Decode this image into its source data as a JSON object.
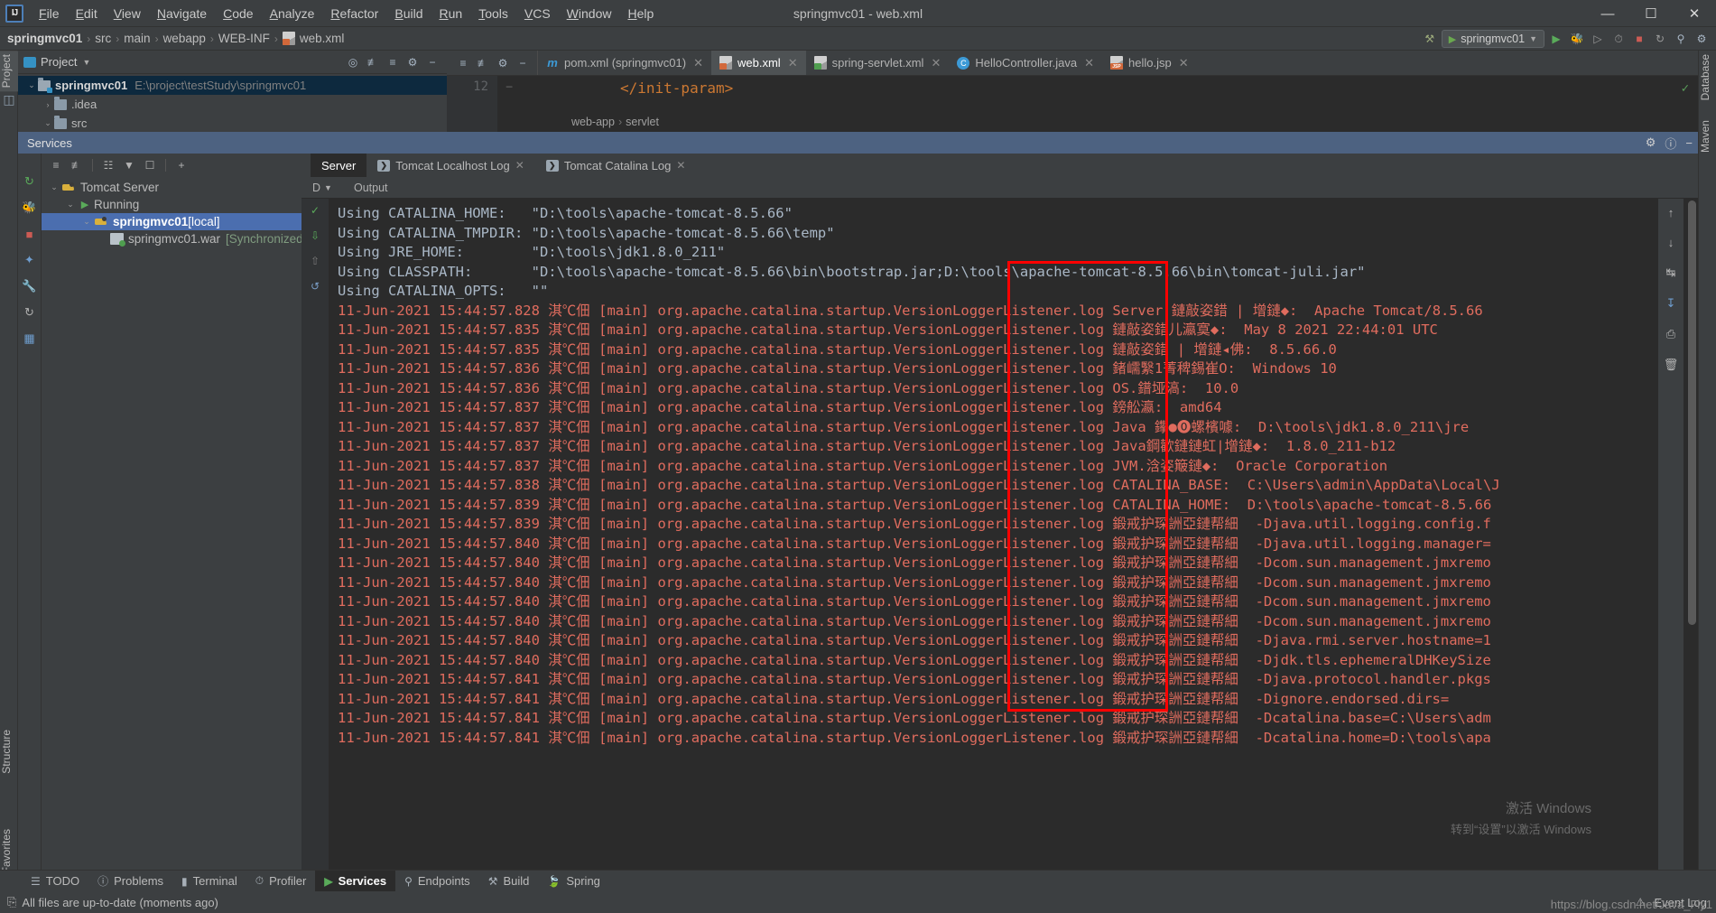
{
  "window": {
    "title": "springmvc01 - web.xml",
    "controls": {
      "minimize": "—",
      "maximize": "☐",
      "close": "✕"
    }
  },
  "menu": {
    "items": [
      "File",
      "Edit",
      "View",
      "Navigate",
      "Code",
      "Analyze",
      "Refactor",
      "Build",
      "Run",
      "Tools",
      "VCS",
      "Window",
      "Help"
    ]
  },
  "navbar": {
    "crumbs": [
      "springmvc01",
      "src",
      "main",
      "webapp",
      "WEB-INF",
      "web.xml"
    ],
    "run_config": "springmvc01",
    "sep": "›"
  },
  "left_strip": {
    "project_label": "Project",
    "structure_label": "Structure",
    "favorites_label": "Favorites"
  },
  "right_strip": {
    "database_label": "Database",
    "maven_label": "Maven"
  },
  "project_panel": {
    "title": "Project",
    "tree": [
      {
        "label": "springmvc01",
        "path": "E:\\project\\testStudy\\springmvc01",
        "bold": true,
        "selected": true,
        "arrow": "⌄",
        "indent": 0
      },
      {
        "label": ".idea",
        "path": "",
        "bold": false,
        "selected": false,
        "arrow": "›",
        "indent": 1
      },
      {
        "label": "src",
        "path": "",
        "bold": false,
        "selected": false,
        "arrow": "⌄",
        "indent": 1
      }
    ]
  },
  "editor": {
    "tabs": [
      {
        "label": "pom.xml (springmvc01)",
        "icon": "maven-icon",
        "active": false
      },
      {
        "label": "web.xml",
        "icon": "xml-file-icon",
        "active": true
      },
      {
        "label": "spring-servlet.xml",
        "icon": "xml-file-ok-icon",
        "active": false
      },
      {
        "label": "HelloController.java",
        "icon": "java-class-icon",
        "active": false
      },
      {
        "label": "hello.jsp",
        "icon": "jsp-file-icon",
        "active": false
      }
    ],
    "line_number": "12",
    "code_line": "</init-param>",
    "breadcrumbs": [
      "web-app",
      "servlet"
    ],
    "close_glyph": "✕"
  },
  "services": {
    "title": "Services",
    "toolbar_icons": [
      "expand-all-icon",
      "collapse-all-icon",
      "group-icon",
      "filter-icon",
      "add-frame-icon",
      "add-icon"
    ],
    "tree": [
      {
        "label": "Tomcat Server",
        "icon": "tomcat-icon",
        "arrow": "⌄",
        "indent": 0,
        "selected": false,
        "note": ""
      },
      {
        "label": "Running",
        "icon": "play-icon",
        "arrow": "⌄",
        "indent": 1,
        "selected": false,
        "note": ""
      },
      {
        "label": "springmvc01",
        "suffix": " [local]",
        "icon": "tomcat-icon",
        "arrow": "⌄",
        "indent": 2,
        "selected": true,
        "note": ""
      },
      {
        "label": "springmvc01.war",
        "icon": "war-artifact-icon",
        "arrow": "",
        "indent": 3,
        "selected": false,
        "note": "[Synchronized]"
      }
    ],
    "console_tabs": [
      {
        "label": "Server",
        "active": true,
        "badge": "",
        "closable": false
      },
      {
        "label": "Tomcat Localhost Log",
        "active": false,
        "badge": "❯",
        "closable": true
      },
      {
        "label": "Tomcat Catalina Log",
        "active": false,
        "badge": "❯",
        "closable": true
      }
    ],
    "sub_header": {
      "d_column": "D",
      "output_column": "Output",
      "chevron": "⌄"
    }
  },
  "console": {
    "header_lines": [
      "Using CATALINA_HOME:   \"D:\\tools\\apache-tomcat-8.5.66\"",
      "Using CATALINA_TMPDIR: \"D:\\tools\\apache-tomcat-8.5.66\\temp\"",
      "Using JRE_HOME:        \"D:\\tools\\jdk1.8.0_211\"",
      "Using CLASSPATH:       \"D:\\tools\\apache-tomcat-8.5.66\\bin\\bootstrap.jar;D:\\tools\\apache-tomcat-8.5.66\\bin\\tomcat-juli.jar\"",
      "Using CATALINA_OPTS:   \"\""
    ],
    "log_prefix": "11-Jun-2021 15:44:57.",
    "log_rows": [
      {
        "ms": "828",
        "enc": "淇℃佃",
        "thread": "[main]",
        "logger": "org.apache.catalina.startup.VersionLoggerListener.log",
        "key": "Server.鏈敲姿錯 | 增鏈◆:",
        "value": "Apache Tomcat/8.5.66"
      },
      {
        "ms": "835",
        "enc": "淇℃佃",
        "thread": "[main]",
        "logger": "org.apache.catalina.startup.VersionLoggerListener.log",
        "key": "鏈敲姿錯儿瀛寞◆:",
        "value": "May 8 2021 22:44:01 UTC"
      },
      {
        "ms": "835",
        "enc": "淇℃佃",
        "thread": "[main]",
        "logger": "org.apache.catalina.startup.VersionLoggerListener.log",
        "key": "鏈敲姿錯 | 增鏈◂佛:",
        "value": "8.5.66.0"
      },
      {
        "ms": "836",
        "enc": "淇℃佃",
        "thread": "[main]",
        "logger": "org.apache.catalina.startup.VersionLoggerListener.log",
        "key": "鍺嶿繄1菁稗錫崔O:",
        "value": "Windows 10"
      },
      {
        "ms": "836",
        "enc": "淇℃佃",
        "thread": "[main]",
        "logger": "org.apache.catalina.startup.VersionLoggerListener.log",
        "key": "OS.鐠垭滈:",
        "value": "10.0"
      },
      {
        "ms": "837",
        "enc": "淇℃佃",
        "thread": "[main]",
        "logger": "org.apache.catalina.startup.VersionLoggerListener.log",
        "key": "鎊舩瀛:",
        "value": "amd64"
      },
      {
        "ms": "837",
        "enc": "淇℃佃",
        "thread": "[main]",
        "logger": "org.apache.catalina.startup.VersionLoggerListener.log",
        "key": "Java 鑻●⓿螺檳噱:",
        "value": "D:\\tools\\jdk1.8.0_211\\jre"
      },
      {
        "ms": "837",
        "enc": "淇℃佃",
        "thread": "[main]",
        "logger": "org.apache.catalina.startup.VersionLoggerListener.log",
        "key": "Java鋼歡鏈鏈虹|增鏈◆:",
        "value": "1.8.0_211-b12"
      },
      {
        "ms": "837",
        "enc": "淇℃佃",
        "thread": "[main]",
        "logger": "org.apache.catalina.startup.VersionLoggerListener.log",
        "key": "JVM.浛姿簸鏈◆:",
        "value": "Oracle Corporation"
      },
      {
        "ms": "838",
        "enc": "淇℃佃",
        "thread": "[main]",
        "logger": "org.apache.catalina.startup.VersionLoggerListener.log",
        "key": "CATALINA_BASE:",
        "value": "C:\\Users\\admin\\AppData\\Local\\J"
      },
      {
        "ms": "839",
        "enc": "淇℃佃",
        "thread": "[main]",
        "logger": "org.apache.catalina.startup.VersionLoggerListener.log",
        "key": "CATALINA_HOME:",
        "value": "D:\\tools\\apache-tomcat-8.5.66"
      },
      {
        "ms": "839",
        "enc": "淇℃佃",
        "thread": "[main]",
        "logger": "org.apache.catalina.startup.VersionLoggerListener.log",
        "key": "鍛戒护琛詶亞鏈帮細",
        "value": "-Djava.util.logging.config.f"
      },
      {
        "ms": "840",
        "enc": "淇℃佃",
        "thread": "[main]",
        "logger": "org.apache.catalina.startup.VersionLoggerListener.log",
        "key": "鍛戒护琛詶亞鏈帮細",
        "value": "-Djava.util.logging.manager="
      },
      {
        "ms": "840",
        "enc": "淇℃佃",
        "thread": "[main]",
        "logger": "org.apache.catalina.startup.VersionLoggerListener.log",
        "key": "鍛戒护琛詶亞鏈帮細",
        "value": "-Dcom.sun.management.jmxremo"
      },
      {
        "ms": "840",
        "enc": "淇℃佃",
        "thread": "[main]",
        "logger": "org.apache.catalina.startup.VersionLoggerListener.log",
        "key": "鍛戒护琛詶亞鏈帮細",
        "value": "-Dcom.sun.management.jmxremo"
      },
      {
        "ms": "840",
        "enc": "淇℃佃",
        "thread": "[main]",
        "logger": "org.apache.catalina.startup.VersionLoggerListener.log",
        "key": "鍛戒护琛詶亞鏈帮細",
        "value": "-Dcom.sun.management.jmxremo"
      },
      {
        "ms": "840",
        "enc": "淇℃佃",
        "thread": "[main]",
        "logger": "org.apache.catalina.startup.VersionLoggerListener.log",
        "key": "鍛戒护琛詶亞鏈帮細",
        "value": "-Dcom.sun.management.jmxremo"
      },
      {
        "ms": "840",
        "enc": "淇℃佃",
        "thread": "[main]",
        "logger": "org.apache.catalina.startup.VersionLoggerListener.log",
        "key": "鍛戒护琛詶亞鏈帮細",
        "value": "-Djava.rmi.server.hostname=1"
      },
      {
        "ms": "840",
        "enc": "淇℃佃",
        "thread": "[main]",
        "logger": "org.apache.catalina.startup.VersionLoggerListener.log",
        "key": "鍛戒护琛詶亞鏈帮細",
        "value": "-Djdk.tls.ephemeralDHKeySize"
      },
      {
        "ms": "841",
        "enc": "淇℃佃",
        "thread": "[main]",
        "logger": "org.apache.catalina.startup.VersionLoggerListener.log",
        "key": "鍛戒护琛詶亞鏈帮細",
        "value": "-Djava.protocol.handler.pkgs"
      },
      {
        "ms": "841",
        "enc": "淇℃佃",
        "thread": "[main]",
        "logger": "org.apache.catalina.startup.VersionLoggerListener.log",
        "key": "鍛戒护琛詶亞鏈帮細",
        "value": "-Dignore.endorsed.dirs="
      },
      {
        "ms": "841",
        "enc": "淇℃佃",
        "thread": "[main]",
        "logger": "org.apache.catalina.startup.VersionLoggerListener.log",
        "key": "鍛戒护琛詶亞鏈帮細",
        "value": "-Dcatalina.base=C:\\Users\\adm"
      },
      {
        "ms": "841",
        "enc": "淇℃佃",
        "thread": "[main]",
        "logger": "org.apache.catalina.startup.VersionLoggerListener.log",
        "key": "鍛戒护琛詶亞鏈帮細",
        "value": "-Dcatalina.home=D:\\tools\\apa"
      }
    ]
  },
  "watermark": {
    "line1": "激活 Windows",
    "line2": "转到“设置”以激活 Windows",
    "blog": "https://blog.csdn.net/Java_Fly1"
  },
  "tool_windows": [
    {
      "label": "TODO",
      "icon": "todo-icon",
      "active": false
    },
    {
      "label": "Problems",
      "icon": "problems-icon",
      "active": false
    },
    {
      "label": "Terminal",
      "icon": "terminal-icon",
      "active": false
    },
    {
      "label": "Profiler",
      "icon": "profiler-icon",
      "active": false
    },
    {
      "label": "Services",
      "icon": "services-icon",
      "active": true
    },
    {
      "label": "Endpoints",
      "icon": "endpoints-icon",
      "active": false
    },
    {
      "label": "Build",
      "icon": "build-icon",
      "active": false
    },
    {
      "label": "Spring",
      "icon": "spring-icon",
      "active": false
    }
  ],
  "statusbar": {
    "message": "All files are up-to-date (moments ago)",
    "event_log": "Event Log"
  },
  "colors": {
    "accent_blue": "#4b6eaf",
    "selection_blue": "#0d293e",
    "highlight_red": "#ff0000",
    "log_error": "#e06c5e",
    "panel_bg": "#3c3f41",
    "console_bg": "#2b2b2b"
  }
}
